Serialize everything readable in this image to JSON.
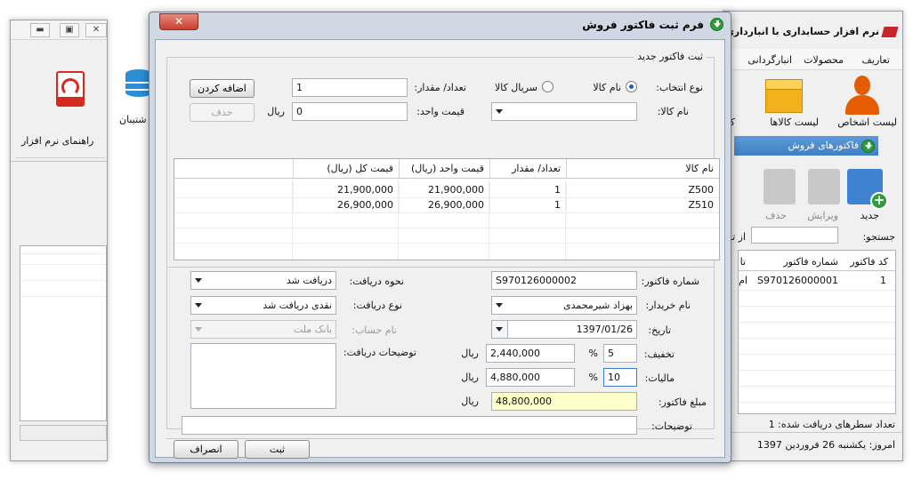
{
  "bg_left": {
    "tool_guide_label": "راهنمای نرم افزار",
    "tool_backup_label": "پشتیبان",
    "backup_visible": "شتیبان"
  },
  "bg_main": {
    "title": "نرم افزار حسابداری با انبارداری آ",
    "menu": [
      "تعاریف",
      "محصولات",
      "انبارگردانی"
    ],
    "tools": {
      "persons": "لیست اشخاص",
      "goods": "لیست کالاها",
      "more": "ک"
    },
    "tab": "فاکتورهای فروش",
    "actions": {
      "new": "جدید",
      "edit": "ویرایش",
      "delete": "حذف"
    },
    "search_label": "جستجو:",
    "from_label": "از تا",
    "grid_headers": [
      "کد فاکتور",
      "شماره فاکتور",
      "تا"
    ],
    "grid_row": [
      "1",
      "S970126000001",
      "ام"
    ],
    "status_rows": "تعداد سطرهای دریافت شده:  1",
    "status_date": "امروز: یکشنبه 26 فروردین 1397"
  },
  "dialog": {
    "title": "فرم ثبت فاکتور فروش",
    "group_title": "ثبت فاکتور جدید",
    "select_type_label": "نوع انتخاب:",
    "radio_name": "نام کالا",
    "radio_serial": "سریال کالا",
    "qty_label": "تعداد/ مقدار:",
    "qty_value": "1",
    "add_button": "اضافه کردن",
    "product_name_label": "نام کالا:",
    "unit_price_label": "قیمت واحد:",
    "unit_price_value": "0",
    "rial": "ریال",
    "delete_button": "حذف",
    "grid": {
      "headers": [
        "نام کالا",
        "تعداد/ مقدار",
        "قیمت واحد (ریال)",
        "قیمت کل (ریال)"
      ],
      "rows": [
        [
          "Z500",
          "1",
          "21,900,000",
          "21,900,000"
        ],
        [
          "Z510",
          "1",
          "26,900,000",
          "26,900,000"
        ]
      ]
    },
    "invoice_no_label": "شماره فاکتور:",
    "invoice_no_value": "S970126000002",
    "buyer_label": "نام خریدار:",
    "buyer_value": "بهزاد شیرمحمدی",
    "date_label": "تاریخ:",
    "date_value": "1397/01/26",
    "discount_label": "تخفیف:",
    "discount_percent": "5",
    "discount_amount": "2,440,000",
    "tax_label": "مالیات:",
    "tax_percent": "10",
    "tax_amount": "4,880,000",
    "percent_sign": "%",
    "total_label": "مبلغ فاکتور:",
    "total_value": "48,800,000",
    "notes_label": "توضیحات:",
    "receive_method_label": "نحوه دریافت:",
    "receive_method_value": "دریافت شد",
    "receive_type_label": "نوع دریافت:",
    "receive_type_value": "نقدی دریافت شد",
    "account_label": "نام حساب:",
    "account_value": "بانک ملت",
    "receive_notes_label": "توضیحات دریافت:",
    "save_button": "ثبت",
    "cancel_button": "انصراف"
  },
  "colors": {
    "accent": "#3f7fc4",
    "total_bg": "#ffffcc",
    "close": "#c8412f",
    "green": "#2e9c3a"
  }
}
